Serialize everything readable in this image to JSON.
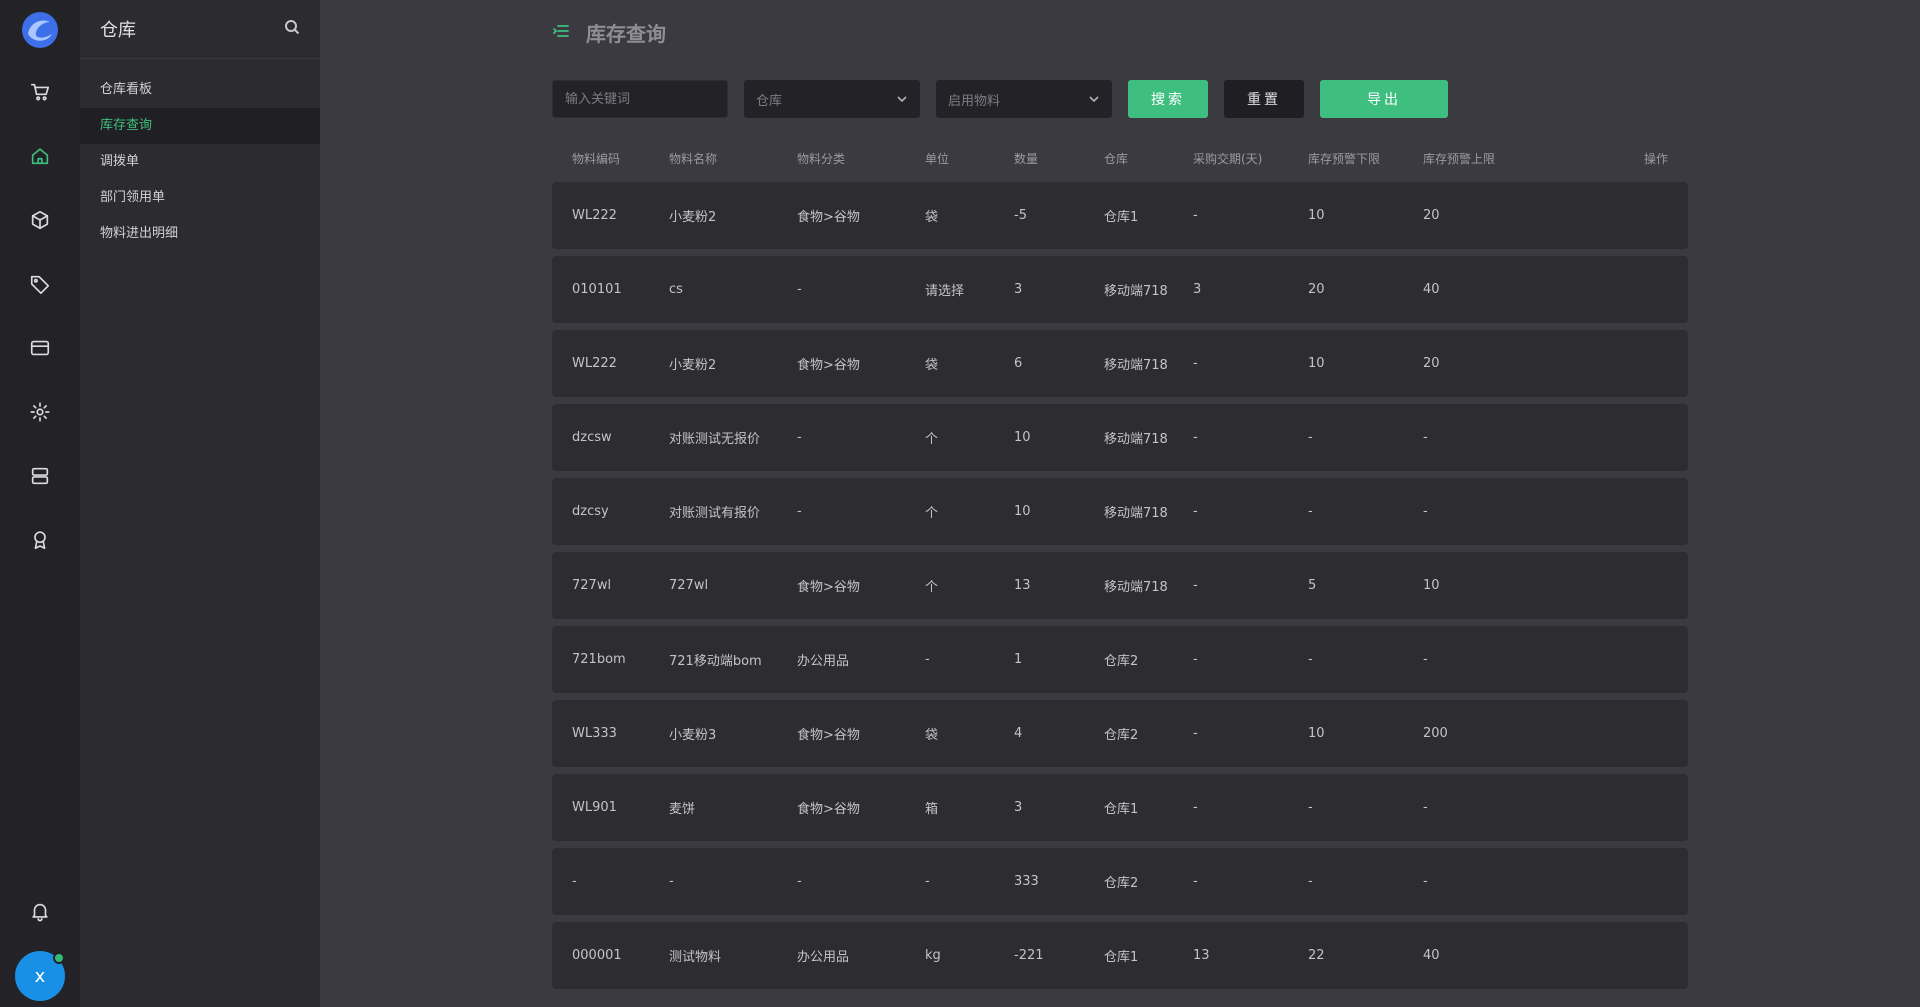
{
  "app": {
    "logo": "app-logo",
    "rail": [
      "cart-icon",
      "home-icon",
      "box-icon",
      "tag-icon",
      "card-icon",
      "gear-icon",
      "server-icon",
      "award-icon"
    ],
    "bell": "bell-icon",
    "avatar_letter": "x",
    "accent_color": "#3fbf7f"
  },
  "submenu": {
    "title": "仓库",
    "items": [
      "仓库看板",
      "库存查询",
      "调拨单",
      "部门领用单",
      "物料进出明细"
    ],
    "active_index": 1
  },
  "page": {
    "title": "库存查询"
  },
  "filters": {
    "keyword_placeholder": "输入关键词",
    "warehouse_placeholder": "仓库",
    "material_status_placeholder": "启用物料",
    "search_label": "搜索",
    "reset_label": "重置",
    "export_label": "导出"
  },
  "table": {
    "columns": [
      "物料编码",
      "物料名称",
      "物料分类",
      "单位",
      "数量",
      "仓库",
      "采购交期(天)",
      "库存预警下限",
      "库存预警上限",
      "操作"
    ],
    "rows": [
      [
        "WL222",
        "小麦粉2",
        "食物>谷物",
        "袋",
        "-5",
        "仓库1",
        "-",
        "10",
        "20",
        ""
      ],
      [
        "010101",
        "cs",
        "-",
        "请选择",
        "3",
        "移动端718",
        "3",
        "20",
        "40",
        ""
      ],
      [
        "WL222",
        "小麦粉2",
        "食物>谷物",
        "袋",
        "6",
        "移动端718",
        "-",
        "10",
        "20",
        ""
      ],
      [
        "dzcsw",
        "对账测试无报价",
        "-",
        "个",
        "10",
        "移动端718",
        "-",
        "-",
        "-",
        ""
      ],
      [
        "dzcsy",
        "对账测试有报价",
        "-",
        "个",
        "10",
        "移动端718",
        "-",
        "-",
        "-",
        ""
      ],
      [
        "727wl",
        "727wl",
        "食物>谷物",
        "个",
        "13",
        "移动端718",
        "-",
        "5",
        "10",
        ""
      ],
      [
        "721bom",
        "721移动端bom",
        "办公用品",
        "-",
        "1",
        "仓库2",
        "-",
        "-",
        "-",
        ""
      ],
      [
        "WL333",
        "小麦粉3",
        "食物>谷物",
        "袋",
        "4",
        "仓库2",
        "-",
        "10",
        "200",
        ""
      ],
      [
        "WL901",
        "麦饼",
        "食物>谷物",
        "箱",
        "3",
        "仓库1",
        "-",
        "-",
        "-",
        ""
      ],
      [
        "-",
        "-",
        "-",
        "-",
        "333",
        "仓库2",
        "-",
        "-",
        "-",
        ""
      ],
      [
        "000001",
        "测试物料",
        "办公用品",
        "kg",
        "-221",
        "仓库1",
        "13",
        "22",
        "40",
        ""
      ]
    ]
  }
}
